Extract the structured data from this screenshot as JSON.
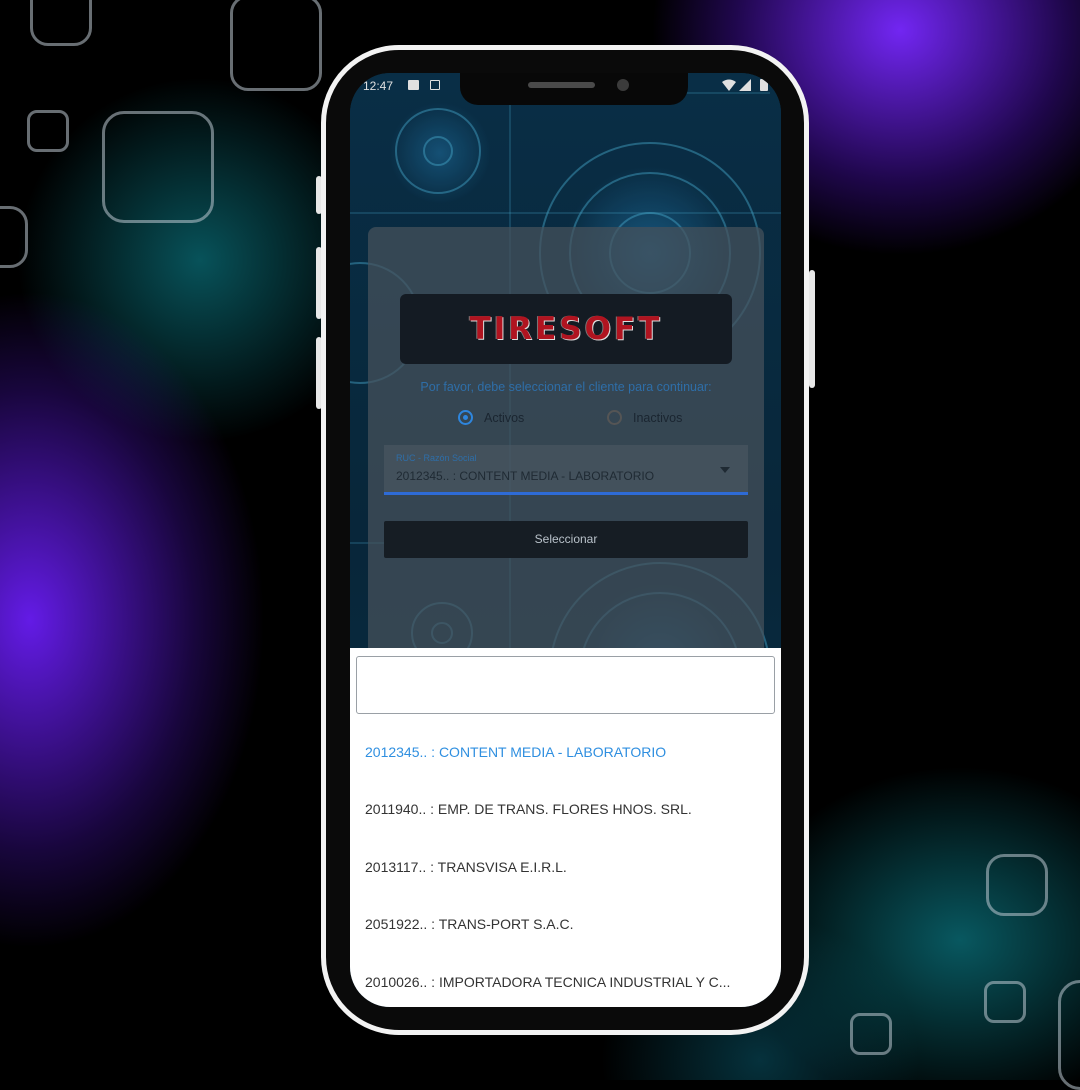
{
  "status_bar": {
    "time": "12:47"
  },
  "app": {
    "logo_text": "TIRESOFT",
    "prompt": "Por favor, debe seleccionar el cliente para continuar:",
    "radio_options": [
      {
        "label": "Activos",
        "selected": true
      },
      {
        "label": "Inactivos",
        "selected": false
      }
    ],
    "select_field": {
      "label": "RUC - Razón Social",
      "value": "2012345.. : CONTENT MEDIA - LABORATORIO"
    },
    "select_button": "Seleccionar"
  },
  "dropdown": {
    "search_value": "",
    "options": [
      "2012345.. : CONTENT MEDIA - LABORATORIO",
      "2011940.. : EMP. DE TRANS. FLORES HNOS. SRL.",
      "2013117.. : TRANSVISA E.I.R.L.",
      "2051922.. : TRANS-PORT S.A.C.",
      "2010026.. : IMPORTADORA TECNICA INDUSTRIAL Y C..."
    ],
    "selected_index": 0
  },
  "colors": {
    "accent_blue": "#2f8fe0",
    "logo_red": "#b01420",
    "card_gray": "#46525c",
    "button_dark": "#161d24"
  }
}
